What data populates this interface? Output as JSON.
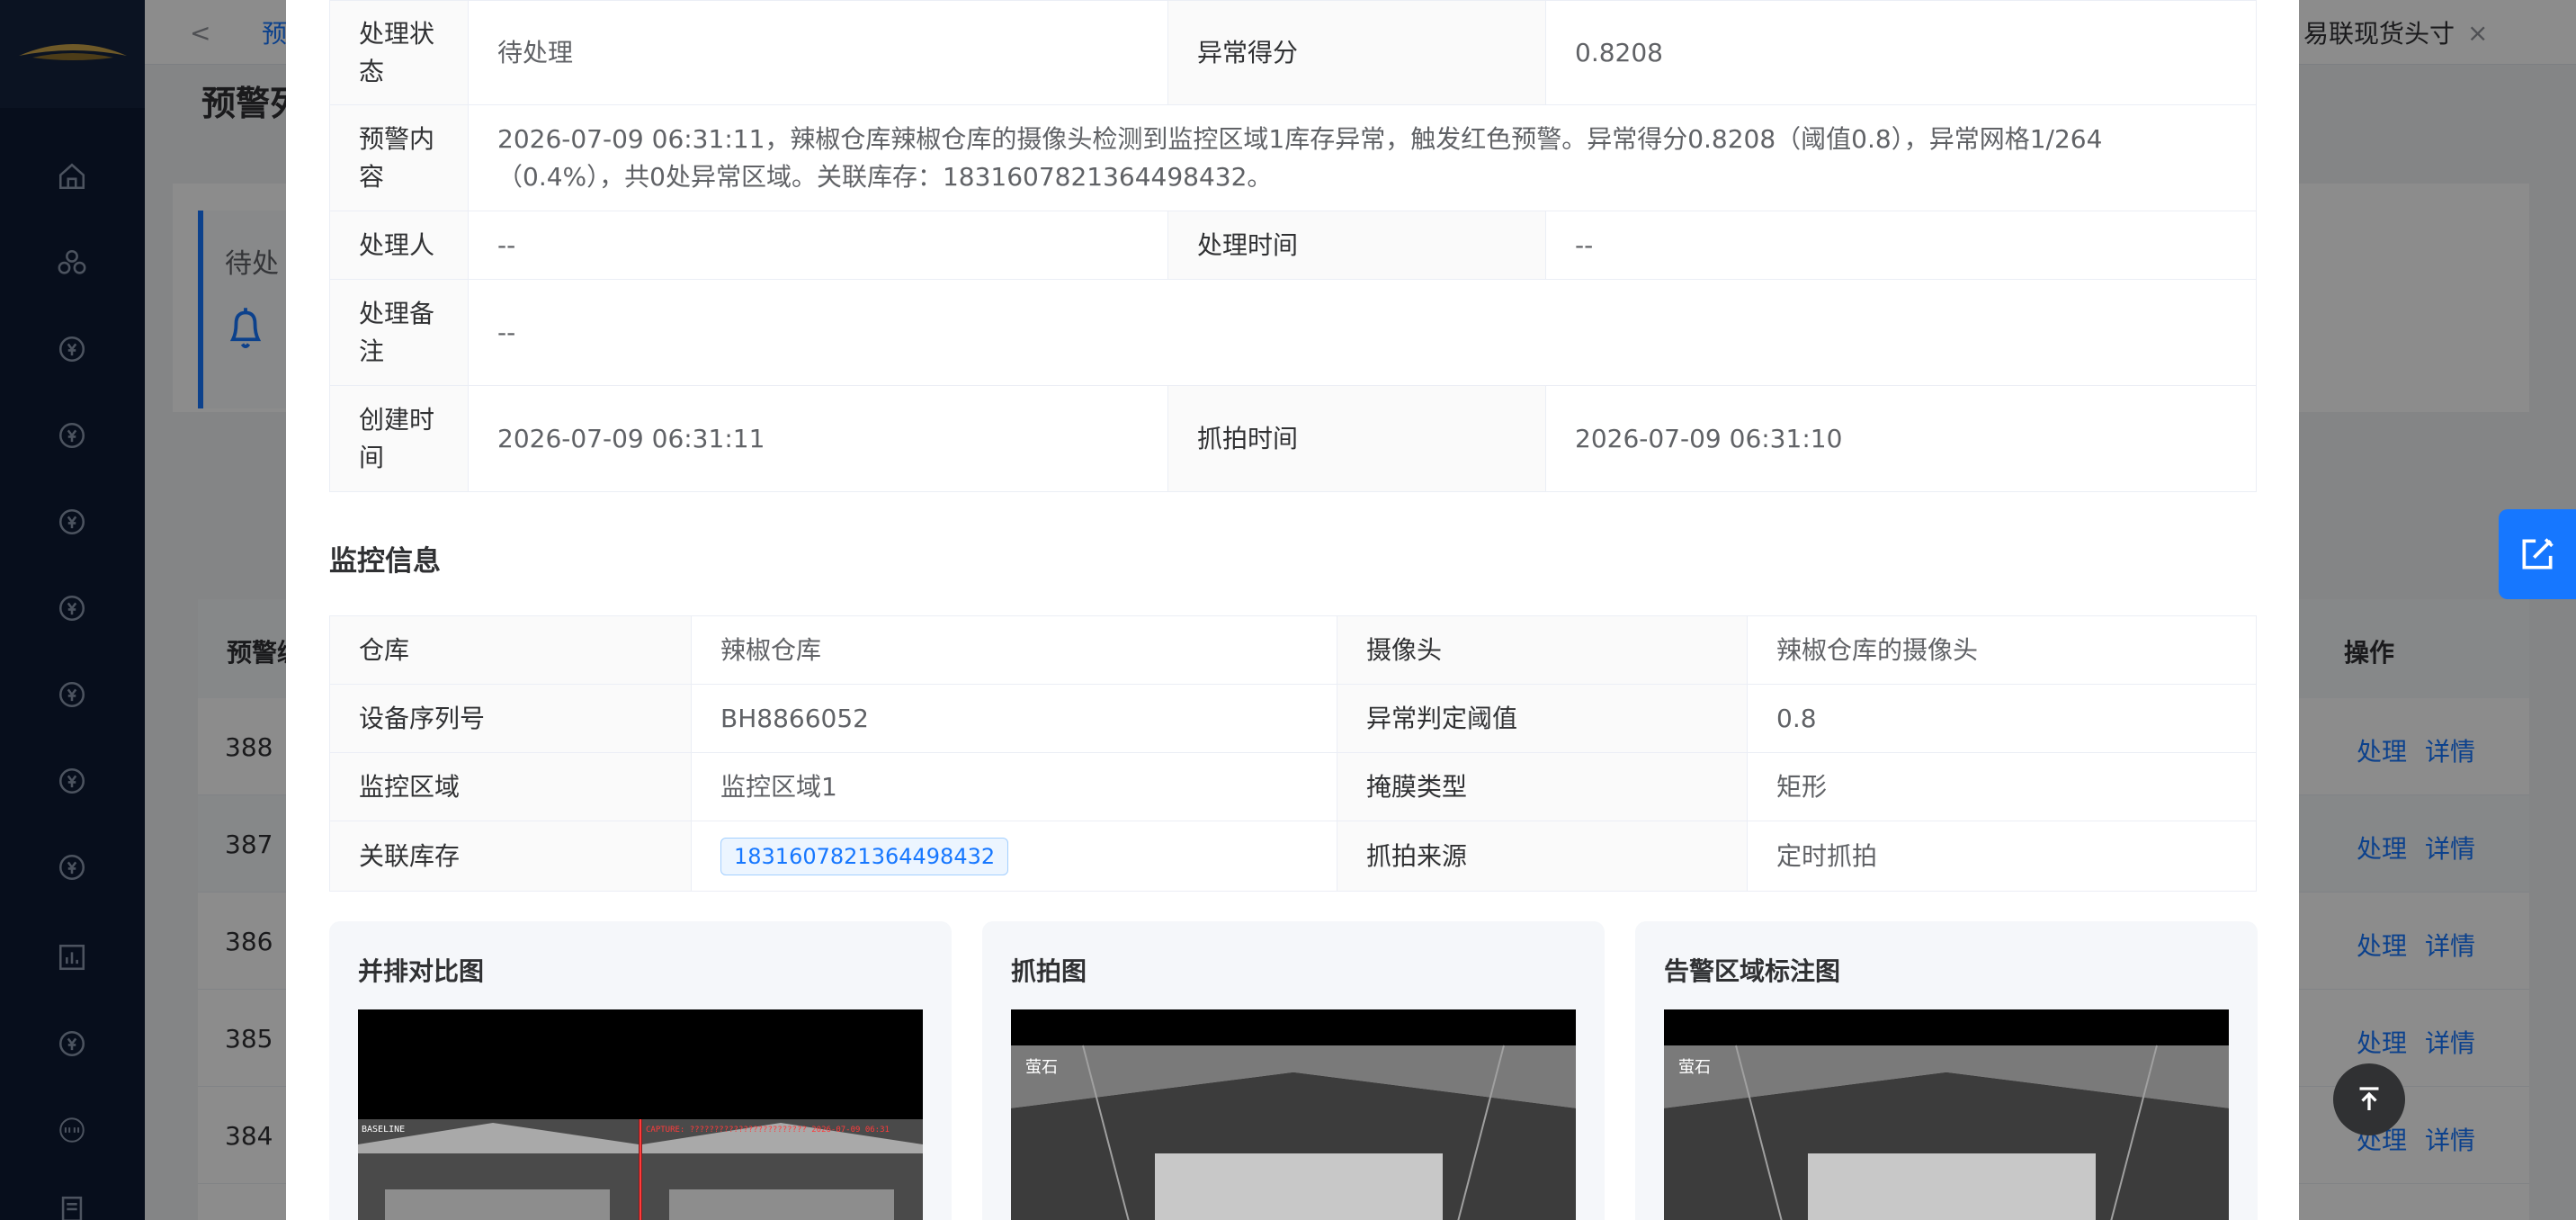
{
  "tabs": {
    "prev_arrow": "<",
    "tab_partial": "预",
    "tab_last": "易联现货头寸",
    "tab_close": "×"
  },
  "background": {
    "page_title_partial": "预警列",
    "card_label_partial": "待处",
    "table_head_partial": "预警编",
    "table_head_actions": "操作",
    "rows": [
      {
        "id": "388",
        "handle": "处理",
        "detail": "详情"
      },
      {
        "id": "387",
        "handle": "处理",
        "detail": "详情"
      },
      {
        "id": "386",
        "handle": "处理",
        "detail": "详情"
      },
      {
        "id": "385",
        "handle": "处理",
        "detail": "详情"
      },
      {
        "id": "384",
        "handle": "处理",
        "detail": "详情"
      }
    ]
  },
  "alert_info": {
    "status_label": "处理状态",
    "status_value": "待处理",
    "score_label": "异常得分",
    "score_value": "0.8208",
    "content_label": "预警内容",
    "content_value": "2026-07-09 06:31:11，辣椒仓库辣椒仓库的摄像头检测到监控区域1库存异常，触发红色预警。异常得分0.8208（阈值0.8），异常网格1/264（0.4%），共0处异常区域。关联库存：1831607821364498432。",
    "handler_label": "处理人",
    "handler_value": "--",
    "handle_time_label": "处理时间",
    "handle_time_value": "--",
    "note_label": "处理备注",
    "note_value": "--",
    "created_label": "创建时间",
    "created_value": "2026-07-09 06:31:11",
    "capture_time_label": "抓拍时间",
    "capture_time_value": "2026-07-09 06:31:10"
  },
  "monitor_info": {
    "section_title": "监控信息",
    "warehouse_label": "仓库",
    "warehouse_value": "辣椒仓库",
    "camera_label": "摄像头",
    "camera_value": "辣椒仓库的摄像头",
    "serial_label": "设备序列号",
    "serial_value": "BH8866052",
    "threshold_label": "异常判定阈值",
    "threshold_value": "0.8",
    "zone_label": "监控区域",
    "zone_value": "监控区域1",
    "mask_label": "掩膜类型",
    "mask_value": "矩形",
    "stock_label": "关联库存",
    "stock_value": "1831607821364498432",
    "source_label": "抓拍来源",
    "source_value": "定时抓拍"
  },
  "images": {
    "compare_title": "并排对比图",
    "capture_title": "抓拍图",
    "annotated_title": "告警区域标注图",
    "baseline_tag": "BASELINE",
    "capture_tag": "CAPTURE: ????????????????????????  2026-07-09 06:31",
    "brand": "萤石"
  },
  "colors": {
    "primary": "#1677ff",
    "sidebar": "#0e1b34",
    "alert_red": "#ff3b3b"
  }
}
